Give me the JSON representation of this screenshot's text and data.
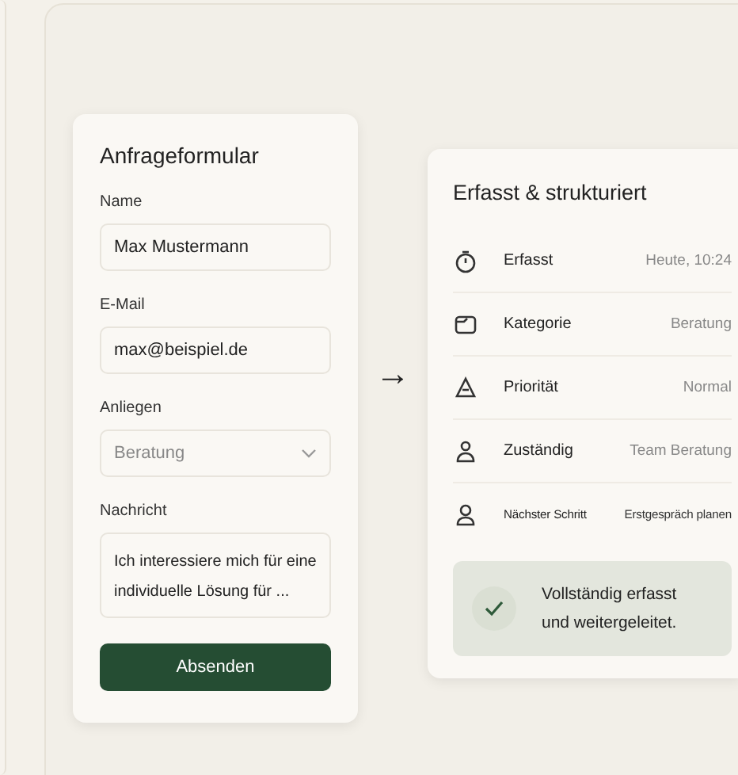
{
  "form": {
    "title": "Anfrageformular",
    "fields": [
      {
        "kind": "text",
        "label": "Name",
        "value": "Max Mustermann"
      },
      {
        "kind": "text",
        "label": "E-Mail",
        "value": "max@beispiel.de"
      },
      {
        "kind": "select",
        "label": "Anliegen",
        "placeholder": "Beratung"
      },
      {
        "kind": "textarea",
        "label": "Nachricht",
        "value": "Ich interessiere mich für eine individuelle Lösung für ..."
      }
    ],
    "submit": "Absenden"
  },
  "arrow": "→",
  "summary": {
    "title": "Erfasst & strukturiert",
    "rows": [
      {
        "label": "Erfasst",
        "value": "Heute, 10:24"
      },
      {
        "label": "Kategorie",
        "value": "Beratung"
      },
      {
        "label": "Priorität",
        "value": "Normal"
      },
      {
        "label": "Zuständig",
        "value": "Team Beratung"
      },
      {
        "label": "Nächster Schritt",
        "value": "Erstgespräch planen"
      }
    ],
    "status": {
      "line1": "Vollständig erfasst",
      "line2": "und weitergeleitet."
    }
  }
}
